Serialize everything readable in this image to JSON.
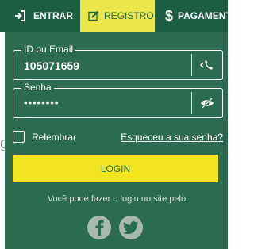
{
  "nav": {
    "tabs": [
      {
        "label": "ENTRAR",
        "icon": "sign-in-icon"
      },
      {
        "label": "REGISTRO",
        "icon": "edit-icon"
      },
      {
        "label": "PAGAMENT",
        "icon": "dollar-icon"
      }
    ]
  },
  "page": {
    "fragment_text": "g"
  },
  "login_form": {
    "id_field": {
      "label": "ID ou Email",
      "value": "105071659",
      "icon": "phone-icon"
    },
    "password_field": {
      "label": "Senha",
      "value": "••••••••",
      "icon": "eye-slash-icon"
    },
    "remember_label": "Relembrar",
    "forgot_link": "Esqueceu a sua senha?",
    "login_button": "LOGIN",
    "social_text": "Você pode fazer o login no site pelo:",
    "social": [
      {
        "name": "facebook",
        "icon": "facebook-icon"
      },
      {
        "name": "twitter",
        "icon": "twitter-icon"
      }
    ]
  },
  "colors": {
    "nav_bg": "#1c5e44",
    "panel_bg": "#2b6b4f",
    "active_tab": "#ece54b",
    "login_button": "#f2e51d",
    "social_circle": "#a7b8ad"
  }
}
